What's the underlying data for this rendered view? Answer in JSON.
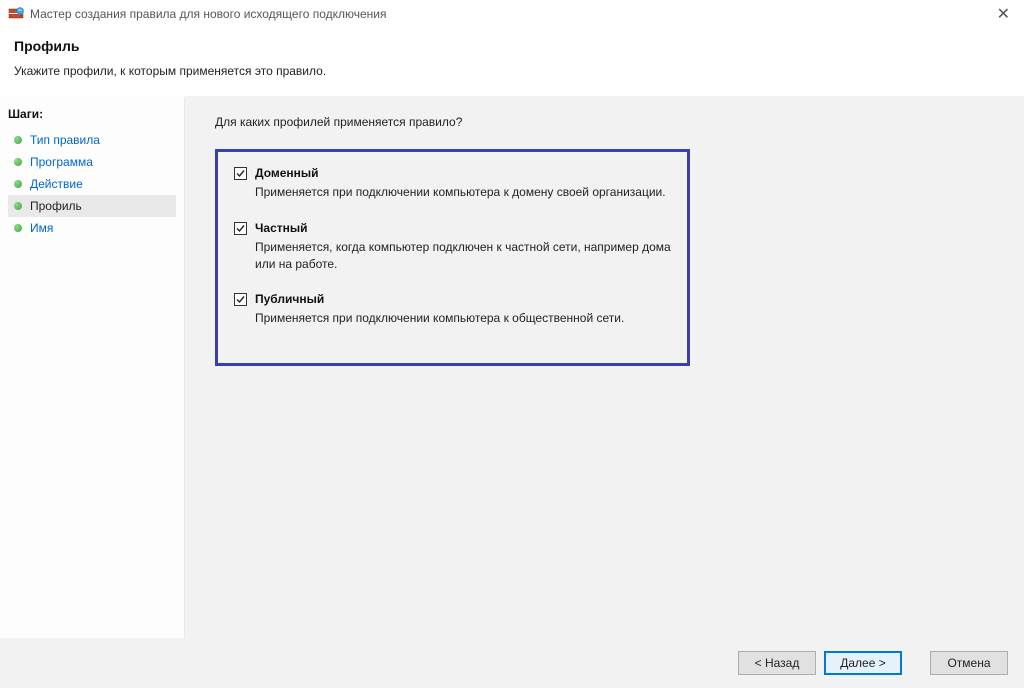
{
  "window": {
    "title": "Мастер создания правила для нового исходящего подключения"
  },
  "header": {
    "title": "Профиль",
    "subtitle": "Укажите профили, к которым применяется это правило."
  },
  "sidebar": {
    "steps_label": "Шаги:",
    "items": [
      {
        "label": "Тип правила",
        "state": "link"
      },
      {
        "label": "Программа",
        "state": "link"
      },
      {
        "label": "Действие",
        "state": "link"
      },
      {
        "label": "Профиль",
        "state": "active"
      },
      {
        "label": "Имя",
        "state": "link"
      }
    ]
  },
  "content": {
    "question": "Для каких профилей применяется правило?",
    "options": [
      {
        "label": "Доменный",
        "description": "Применяется при подключении компьютера к домену своей организации.",
        "checked": true
      },
      {
        "label": "Частный",
        "description": "Применяется, когда компьютер подключен к частной сети, например дома или на работе.",
        "checked": true
      },
      {
        "label": "Публичный",
        "description": "Применяется при подключении компьютера к общественной сети.",
        "checked": true
      }
    ]
  },
  "buttons": {
    "back": "< Назад",
    "next": "Далее >",
    "cancel": "Отмена"
  }
}
